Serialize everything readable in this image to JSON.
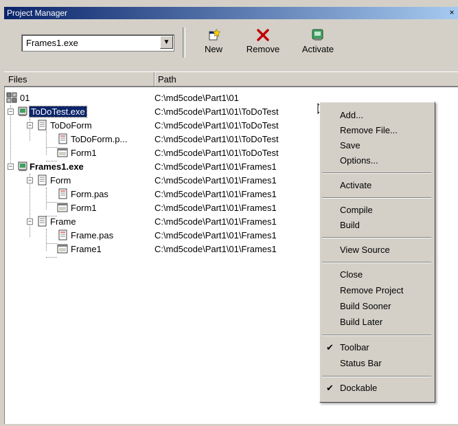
{
  "window": {
    "title": "Project Manager",
    "close_glyph": "×"
  },
  "toolbar": {
    "combo_value": "Frames1.exe",
    "combo_arrow": "▼",
    "new_label": "New",
    "remove_label": "Remove",
    "activate_label": "Activate"
  },
  "columns": {
    "files": "Files",
    "path": "Path"
  },
  "tree": [
    {
      "name": "01",
      "path": "C:\\md5code\\Part1\\01"
    },
    {
      "name": "ToDoTest.exe",
      "path": "C:\\md5code\\Part1\\01\\ToDoTest",
      "selected": true
    },
    {
      "name": "ToDoForm",
      "path": "C:\\md5code\\Part1\\01\\ToDoTest"
    },
    {
      "name": "ToDoForm.p...",
      "path": "C:\\md5code\\Part1\\01\\ToDoTest"
    },
    {
      "name": "Form1",
      "path": "C:\\md5code\\Part1\\01\\ToDoTest"
    },
    {
      "name": "Frames1.exe",
      "path": "C:\\md5code\\Part1\\01\\Frames1",
      "bold": true
    },
    {
      "name": "Form",
      "path": "C:\\md5code\\Part1\\01\\Frames1"
    },
    {
      "name": "Form.pas",
      "path": "C:\\md5code\\Part1\\01\\Frames1"
    },
    {
      "name": "Form1",
      "path": "C:\\md5code\\Part1\\01\\Frames1"
    },
    {
      "name": "Frame",
      "path": "C:\\md5code\\Part1\\01\\Frames1"
    },
    {
      "name": "Frame.pas",
      "path": "C:\\md5code\\Part1\\01\\Frames1"
    },
    {
      "name": "Frame1",
      "path": "C:\\md5code\\Part1\\01\\Frames1"
    }
  ],
  "context_menu": {
    "items": [
      {
        "label": "Add..."
      },
      {
        "label": "Remove File..."
      },
      {
        "label": "Save"
      },
      {
        "label": "Options..."
      },
      {
        "label": "Activate"
      },
      {
        "label": "Compile"
      },
      {
        "label": "Build"
      },
      {
        "label": "View Source"
      },
      {
        "label": "Close"
      },
      {
        "label": "Remove Project"
      },
      {
        "label": "Build Sooner"
      },
      {
        "label": "Build Later"
      },
      {
        "label": "Toolbar",
        "checked": true
      },
      {
        "label": "Status Bar"
      },
      {
        "label": "Dockable",
        "checked": true
      }
    ],
    "check_glyph": "✔"
  },
  "colors": {
    "selection": "#0a246a",
    "face": "#d4d0c8",
    "title_start": "#0a246a",
    "title_end": "#a6caf0"
  },
  "icons": [
    "project-group-icon",
    "exe-project-icon",
    "form-unit-icon",
    "pas-file-icon",
    "form-file-icon",
    "new-icon",
    "remove-icon",
    "activate-icon"
  ]
}
